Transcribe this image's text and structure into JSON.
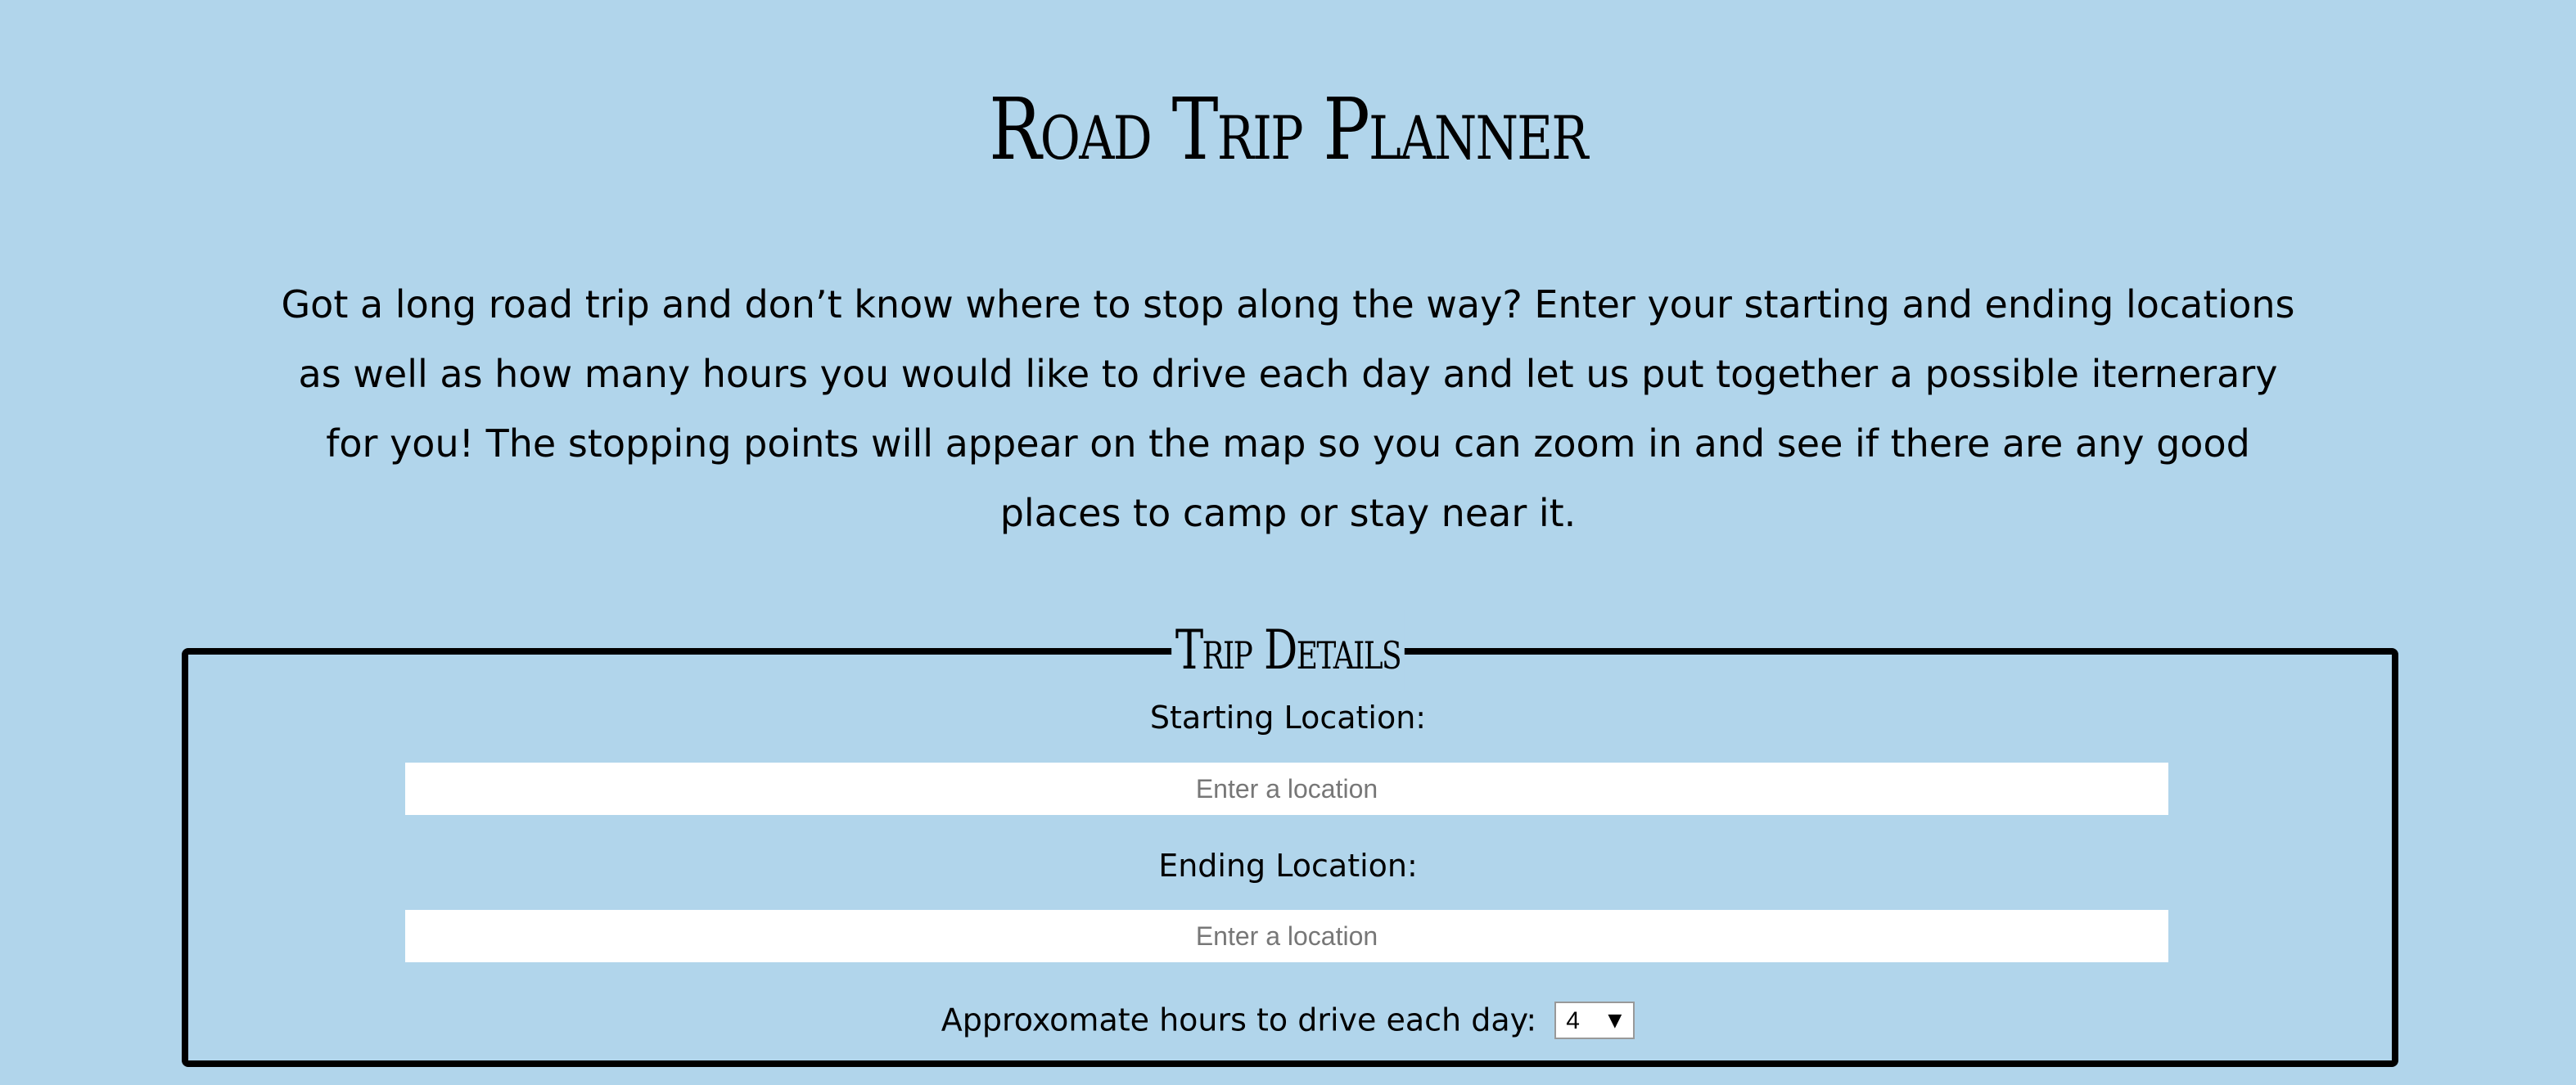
{
  "page": {
    "title": "Road Trip Planner",
    "intro": "Got a long road trip and don’t know where to stop along the way? Enter your starting and ending locations as well as how many hours you would like to drive each day and let us put together a possible iternerary for you! The stopping points will appear on the map so you can zoom in and see if there are any good places to camp or stay near it."
  },
  "trip_details": {
    "legend": "Trip Details",
    "start": {
      "label": "Starting Location:",
      "placeholder": "Enter a location",
      "value": ""
    },
    "end": {
      "label": "Ending Location:",
      "placeholder": "Enter a location",
      "value": ""
    },
    "hours": {
      "label": "Approxomate hours to drive each day:",
      "selected": "4",
      "arrow_icon": "triangle-down"
    }
  },
  "colors": {
    "background": "#b1d5eb",
    "border": "#000000",
    "input_background": "#ffffff",
    "placeholder": "#777777"
  }
}
